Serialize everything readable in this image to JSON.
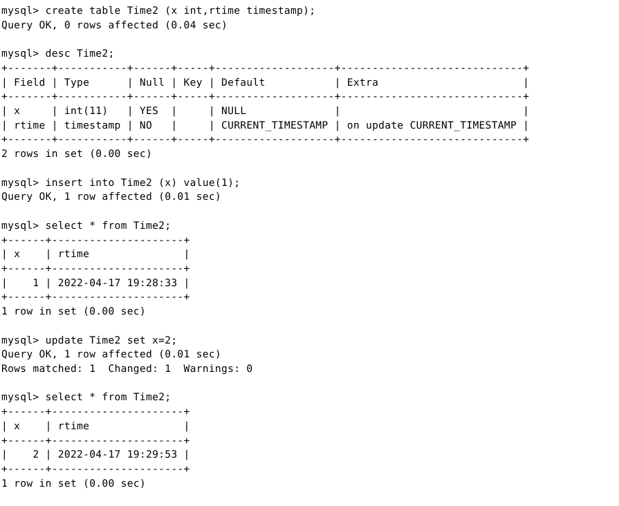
{
  "terminal": {
    "prompt": "mysql>",
    "background_color": "#ffffff",
    "text_color": "#000000",
    "lines": [
      "mysql> create table Time2 (x int,rtime timestamp);",
      "Query OK, 0 rows affected (0.04 sec)",
      "",
      "mysql> desc Time2;",
      "+-------+-----------+------+-----+-------------------+-----------------------------+",
      "| Field | Type      | Null | Key | Default           | Extra                       |",
      "+-------+-----------+------+-----+-------------------+-----------------------------+",
      "| x     | int(11)   | YES  |     | NULL              |                             |",
      "| rtime | timestamp | NO   |     | CURRENT_TIMESTAMP | on update CURRENT_TIMESTAMP |",
      "+-------+-----------+------+-----+-------------------+-----------------------------+",
      "2 rows in set (0.00 sec)",
      "",
      "mysql> insert into Time2 (x) value(1);",
      "Query OK, 1 row affected (0.01 sec)",
      "",
      "mysql> select * from Time2;",
      "+------+---------------------+",
      "| x    | rtime               |",
      "+------+---------------------+",
      "|    1 | 2022-04-17 19:28:33 |",
      "+------+---------------------+",
      "1 row in set (0.00 sec)",
      "",
      "mysql> update Time2 set x=2;",
      "Query OK, 1 row affected (0.01 sec)",
      "Rows matched: 1  Changed: 1  Warnings: 0",
      "",
      "mysql> select * from Time2;",
      "+------+---------------------+",
      "| x    | rtime               |",
      "+------+---------------------+",
      "|    2 | 2022-04-17 19:29:53 |",
      "+------+---------------------+",
      "1 row in set (0.00 sec)"
    ],
    "commands": [
      {
        "sql": "create table Time2 (x int,rtime timestamp);",
        "result": "Query OK, 0 rows affected (0.04 sec)"
      },
      {
        "sql": "desc Time2;",
        "result": "2 rows in set (0.00 sec)"
      },
      {
        "sql": "insert into Time2 (x) value(1);",
        "result": "Query OK, 1 row affected (0.01 sec)"
      },
      {
        "sql": "select * from Time2;",
        "result": "1 row in set (0.00 sec)"
      },
      {
        "sql": "update Time2 set x=2;",
        "result": "Query OK, 1 row affected (0.01 sec)"
      },
      {
        "sql": "select * from Time2;",
        "result": "1 row in set (0.00 sec)"
      }
    ],
    "describe_table": {
      "headers": [
        "Field",
        "Type",
        "Null",
        "Key",
        "Default",
        "Extra"
      ],
      "rows": [
        [
          "x",
          "int(11)",
          "YES",
          "",
          "NULL",
          ""
        ],
        [
          "rtime",
          "timestamp",
          "NO",
          "",
          "CURRENT_TIMESTAMP",
          "on update CURRENT_TIMESTAMP"
        ]
      ],
      "row_count_text": "2 rows in set (0.00 sec)"
    },
    "select_results": [
      {
        "headers": [
          "x",
          "rtime"
        ],
        "rows": [
          [
            "1",
            "2022-04-17 19:28:33"
          ]
        ],
        "row_count_text": "1 row in set (0.00 sec)"
      },
      {
        "headers": [
          "x",
          "rtime"
        ],
        "rows": [
          [
            "2",
            "2022-04-17 19:29:53"
          ]
        ],
        "row_count_text": "1 row in set (0.00 sec)"
      }
    ],
    "update_status": {
      "rows_matched_line": "Rows matched: 1  Changed: 1  Warnings: 0",
      "rows_matched": "1",
      "changed": "1",
      "warnings": "0"
    }
  }
}
